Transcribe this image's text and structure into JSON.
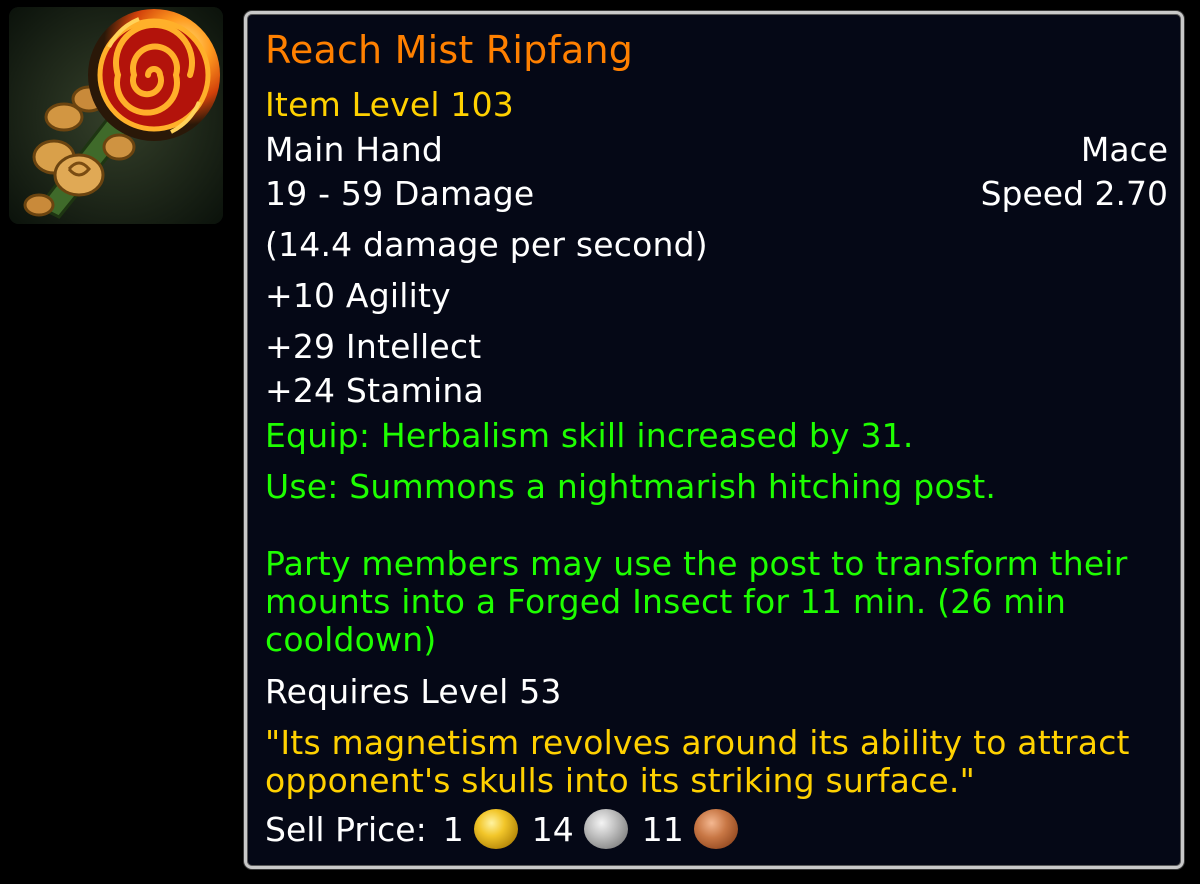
{
  "icon": {
    "name": "flaming-rose-mace-icon"
  },
  "item": {
    "name": "Reach Mist Ripfang",
    "item_level": "Item Level 103",
    "slot": "Main Hand",
    "type": "Mace",
    "damage": "19 - 59 Damage",
    "speed": "Speed 2.70",
    "dps": "(14.4 damage per second)",
    "stats": [
      "+10 Agility",
      "+29 Intellect",
      "+24 Stamina"
    ],
    "equip": "Equip: Herbalism skill increased by 31.",
    "use": "Use: Summons a nightmarish hitching post.",
    "use_detail": "Party members may use the post to transform their mounts into a Forged Insect for 11 min. (26 min cooldown)",
    "requires": "Requires Level 53",
    "flavor": "\"Its magnetism revolves around its ability to attract opponent's skulls into its striking surface.\"",
    "sell_label": "Sell Price:",
    "sell_gold": "1",
    "sell_silver": "14",
    "sell_copper": "11"
  },
  "colors": {
    "name": "#ff8000",
    "item_level": "#ffd100",
    "effect": "#1eff00",
    "flavor": "#ffd100",
    "border": "#c9c9c9",
    "background": "#050816"
  }
}
